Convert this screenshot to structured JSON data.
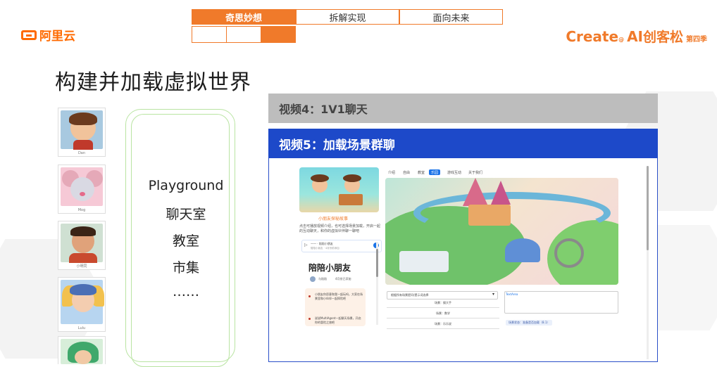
{
  "header": {
    "tabs": [
      "奇思妙想",
      "拆解实现",
      "面向未来"
    ],
    "active_tab_index": 0,
    "accent_color": "#f07a2a"
  },
  "logo_left": {
    "text": "阿里云",
    "icon": "aliyun-bracket-icon"
  },
  "logo_right": {
    "create": "Create",
    "sup": "@",
    "ai": "AI",
    "hackathon": "创客松",
    "season": "第四季"
  },
  "page_title": "构建并加载虚拟世界",
  "avatars": [
    {
      "caption": "Dan",
      "icon": "boy-avatar-icon"
    },
    {
      "caption": "Mog",
      "icon": "mouse-avatar-icon"
    },
    {
      "caption": "小明同",
      "icon": "boy-avatar-icon"
    },
    {
      "caption": "Lulu",
      "icon": "fairy-girl-avatar-icon"
    },
    {
      "caption": "",
      "icon": "green-hair-avatar-icon"
    }
  ],
  "scene_list": [
    "Playground",
    "聊天室",
    "教室",
    "市集",
    "……"
  ],
  "video4": {
    "label": "视频4：1V1聊天",
    "color": "#bdbdbd"
  },
  "video5": {
    "label": "视频5：加载场景群聊",
    "color": "#1d49c9"
  },
  "app": {
    "thumb_title": "小朋友探秘故事",
    "desc": "点击可播放视频介绍，也可选择场景加载，开启一起的互动聊天，和你的虚拟伙伴聊一聊吧",
    "player_title": "一一 · 陪陪小朋友",
    "player_sub": "陪陪小朋友 · 4月份前添加",
    "chat_title": "陪陪小朋友",
    "chat_meta": [
      "与陪陪",
      "4月份已添加"
    ],
    "bubble_lines": [
      "小朋友你愿意和我一起玩吗，大家在场景里和小伙伴一起探险吧",
      "说说MultiAgent一起聊天场景，开启你的冒险之旅吧"
    ],
    "nav": [
      "介绍",
      "自由",
      "教室",
      "乐园",
      "游戏互动",
      "关于我们"
    ],
    "nav_active": 3,
    "dropdown_value": "根据所有场景提问/提示词选择",
    "fields": [
      "场景：操大手",
      "场景：数学",
      "场景：乐乐说"
    ],
    "textbox_label": "TextArea",
    "status_text": "场景状态：准备是否加载（8.1）"
  }
}
